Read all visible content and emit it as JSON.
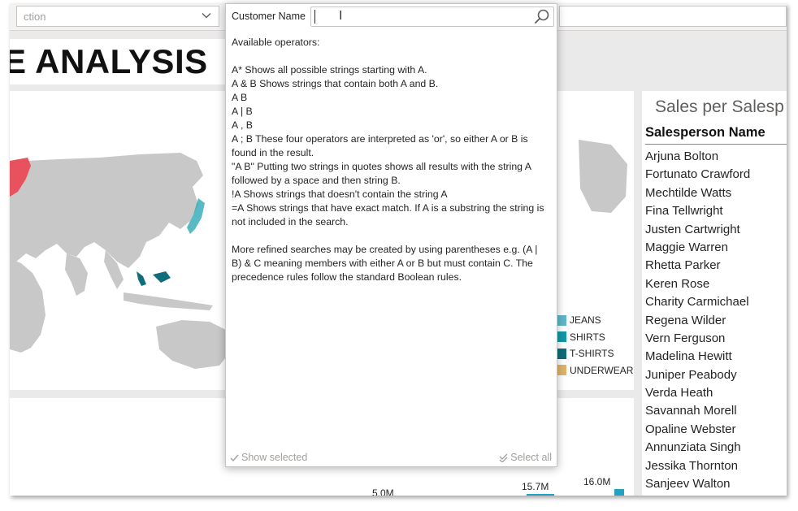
{
  "top_filter": {
    "left_text": "ction",
    "chevron_icon": "chevron-down-icon"
  },
  "page_title": "E ANALYSIS",
  "legend": [
    {
      "label": "JEANS",
      "color": "#5fb7c7"
    },
    {
      "label": "SHIRTS",
      "color": "#1498a8"
    },
    {
      "label": "T-SHIRTS",
      "color": "#0f6e7a"
    },
    {
      "label": "UNDERWEAR",
      "color": "#e0b36b"
    }
  ],
  "map": {
    "land_color": "#c8c8c8",
    "highlight_red": "#e8525f",
    "highlight_teal": "#1fa3b0"
  },
  "bottom_chart": {
    "labels": [
      "15.7M",
      "16.0M",
      "5.0M"
    ],
    "bar_color": "#23a1c1"
  },
  "sales": {
    "title": "Sales per Salesp",
    "header": "Salesperson Name",
    "names": [
      "Arjuna Bolton",
      "Fortunato Crawford",
      "Mechtilde Watts",
      "Fina Tellwright",
      "Justen Cartwright",
      "Maggie Warren",
      "Rhetta Parker",
      "Keren Rose",
      "Charity Carmichael",
      "Regena Wilder",
      "Vern Ferguson",
      "Madelina Hewitt",
      "Juniper Peabody",
      "Verda Heath",
      "Savannah Morell",
      "Opaline Webster",
      "Annunziata Singh",
      "Jessika Thornton",
      "Sanjeev Walton"
    ]
  },
  "popup": {
    "label": "Customer Name",
    "input_value": "",
    "search_icon": "search-icon",
    "help_lines": [
      "Available operators:",
      "",
      "A* Shows all possible strings starting with A.",
      "A & B Shows strings that contain both A and B.",
      "A B",
      "A | B",
      "A , B",
      "A ; B These four operators are interpreted as 'or', so either A or B is found in the result.",
      "\"A B\" Putting two strings in quotes shows all results with the string A followed by a space and then string B.",
      "!A Shows strings that doesn't contain the string A",
      "=A Shows strings that have exact match. If A is a substring the string is not included in the search.",
      "",
      "More refined searches may be created by using parentheses e.g. (A | B) & C meaning members with either A or B but must contain C. The precedence rules follow the standard Boolean rules."
    ],
    "show_selected": "Show selected",
    "select_all": "Select all"
  }
}
